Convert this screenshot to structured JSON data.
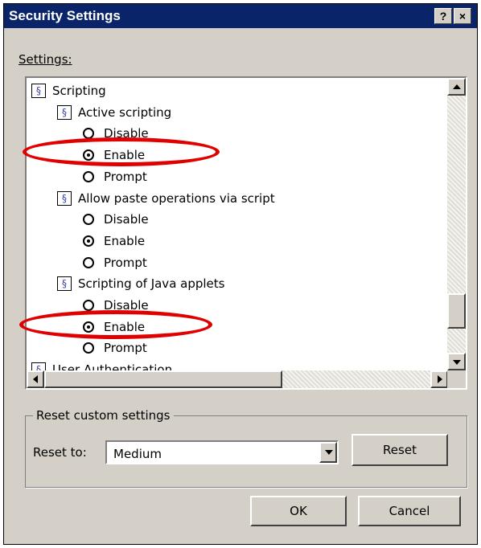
{
  "window": {
    "title": "Security Settings"
  },
  "titlebar_buttons": {
    "help": "?",
    "close": "×"
  },
  "settings_label": "Settings:",
  "tree": [
    {
      "kind": "category",
      "label": "Scripting"
    },
    {
      "kind": "setting",
      "label": "Active scripting"
    },
    {
      "kind": "option",
      "label": "Disable",
      "selected": false
    },
    {
      "kind": "option",
      "label": "Enable",
      "selected": true,
      "highlighted": true
    },
    {
      "kind": "option",
      "label": "Prompt",
      "selected": false
    },
    {
      "kind": "setting",
      "label": "Allow paste operations via script"
    },
    {
      "kind": "option",
      "label": "Disable",
      "selected": false
    },
    {
      "kind": "option",
      "label": "Enable",
      "selected": true
    },
    {
      "kind": "option",
      "label": "Prompt",
      "selected": false
    },
    {
      "kind": "setting",
      "label": "Scripting of Java applets"
    },
    {
      "kind": "option",
      "label": "Disable",
      "selected": false
    },
    {
      "kind": "option",
      "label": "Enable",
      "selected": true,
      "highlighted": true
    },
    {
      "kind": "option",
      "label": "Prompt",
      "selected": false
    },
    {
      "kind": "category",
      "label": "User Authentication"
    }
  ],
  "reset_group": {
    "title": "Reset custom settings",
    "reset_to_label": "Reset to:",
    "reset_to_value": "Medium",
    "reset_button": "Reset"
  },
  "footer": {
    "ok": "OK",
    "cancel": "Cancel"
  },
  "colors": {
    "titlebar": "#0a246a",
    "highlight_ellipse": "#e10000",
    "dialog_bg": "#d4d0c8"
  }
}
